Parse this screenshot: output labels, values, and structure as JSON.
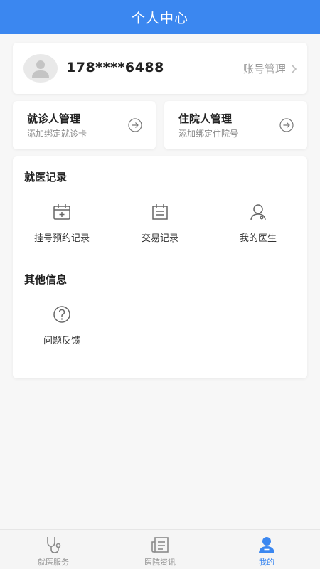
{
  "header": {
    "title": "个人中心"
  },
  "profile": {
    "phone": "178****6488",
    "account_link": "账号管理"
  },
  "management": [
    {
      "title": "就诊人管理",
      "subtitle": "添加绑定就诊卡"
    },
    {
      "title": "住院人管理",
      "subtitle": "添加绑定住院号"
    }
  ],
  "records": {
    "title": "就医记录",
    "items": [
      {
        "label": "挂号预约记录",
        "icon": "calendar-plus-icon"
      },
      {
        "label": "交易记录",
        "icon": "receipt-icon"
      },
      {
        "label": "我的医生",
        "icon": "doctor-icon"
      }
    ]
  },
  "other": {
    "title": "其他信息",
    "items": [
      {
        "label": "问题反馈",
        "icon": "question-icon"
      }
    ]
  },
  "tabbar": {
    "items": [
      {
        "label": "就医服务",
        "icon": "stethoscope-icon"
      },
      {
        "label": "医院资讯",
        "icon": "news-icon"
      },
      {
        "label": "我的",
        "icon": "user-icon",
        "active": true
      }
    ]
  },
  "colors": {
    "primary": "#3b87f0",
    "background": "#f7f7f7",
    "card": "#ffffff",
    "muted_text": "#8a8a8a"
  }
}
